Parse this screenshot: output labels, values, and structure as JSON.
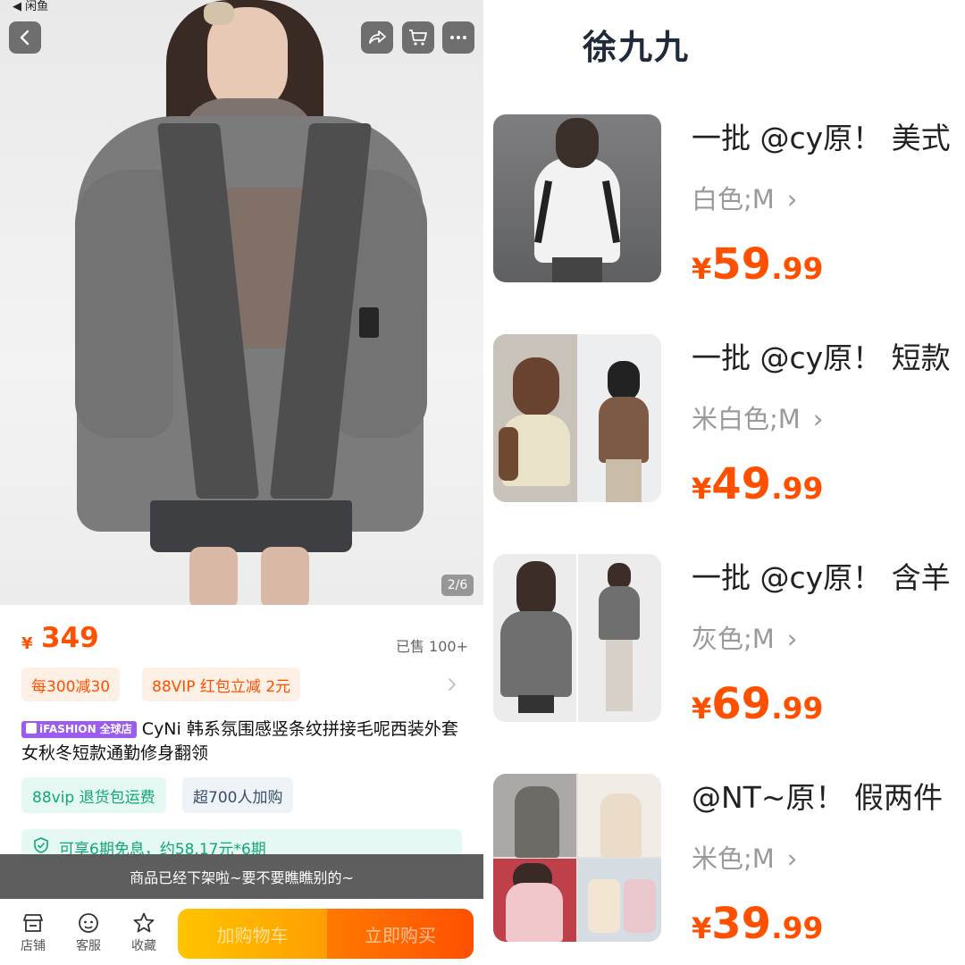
{
  "status_bar": {
    "back_app": "◀ 闲鱼"
  },
  "product": {
    "image_counter": "2/6",
    "price_symbol": "¥",
    "price": "349",
    "sold": "已售 100+",
    "promos": [
      "每300减30",
      "88VIP 红包立减 2元"
    ],
    "brand_badge": "iFASHION 全球店",
    "title": "CyNi 韩系氛围感竖条纹拼接毛呢西装外套女秋冬短款通勤修身翻领",
    "tags": [
      "88vip 退货包运费",
      "超700人加购"
    ],
    "installment": "可享6期免息，约58.17元*6期",
    "toast": "商品已经下架啦~要不要瞧瞧别的~"
  },
  "bottom_bar": {
    "store": "店铺",
    "service": "客服",
    "favorite": "收藏",
    "add_to_cart": "加购物车",
    "buy_now": "立即购买"
  },
  "icons": {
    "back": "chevron-left-icon",
    "share": "share-icon",
    "cart": "cart-icon",
    "more": "more-dots-icon",
    "store": "store-icon",
    "service": "service-face-icon",
    "favorite": "star-icon",
    "check": "shield-check-icon",
    "arrow": "chevron-right-icon"
  },
  "colors": {
    "accent": "#ff5000",
    "green": "#10a870",
    "vip_purple": "#9b5cf0",
    "title_dark": "#1f2a3a"
  },
  "right_panel": {
    "seller": "徐九九",
    "items": [
      {
        "title": "一批 @cy原！ 美式",
        "variant": "白色;M",
        "price_symbol": "¥",
        "price_int": "59",
        "price_dec": ".99"
      },
      {
        "title": "一批 @cy原！  短款",
        "variant": "米白色;M",
        "price_symbol": "¥",
        "price_int": "49",
        "price_dec": ".99"
      },
      {
        "title": "一批 @cy原！  含羊",
        "variant": "灰色;M",
        "price_symbol": "¥",
        "price_int": "69",
        "price_dec": ".99"
      },
      {
        "title": "@NT~原！  假两件",
        "variant": "米色;M",
        "price_symbol": "¥",
        "price_int": "39",
        "price_dec": ".99"
      }
    ]
  }
}
